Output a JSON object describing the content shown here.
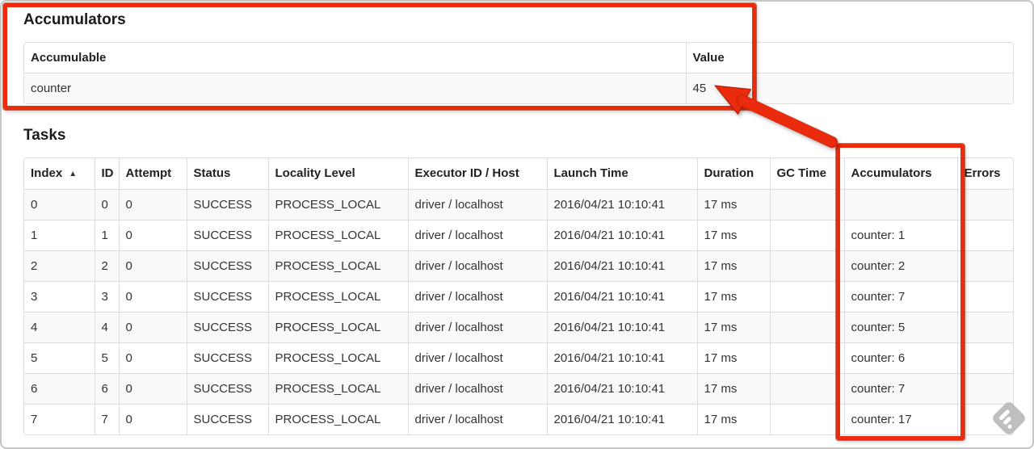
{
  "colors": {
    "annotation_red": "#ea2b0d",
    "table_border": "#dddddd",
    "row_stripe": "#f9f9f9",
    "text": "#333333",
    "watermark_gray": "#bababa"
  },
  "accumulators_section": {
    "title": "Accumulators",
    "table": {
      "headers": [
        "Accumulable",
        "Value"
      ],
      "row": {
        "accumulable": "counter",
        "value": "45"
      }
    }
  },
  "tasks_section": {
    "title": "Tasks",
    "table": {
      "headers": [
        "Index",
        "ID",
        "Attempt",
        "Status",
        "Locality Level",
        "Executor ID / Host",
        "Launch Time",
        "Duration",
        "GC Time",
        "Accumulators",
        "Errors"
      ],
      "sort": {
        "column": "Index",
        "direction": "ascending",
        "icon": "▲"
      },
      "rows": [
        [
          "0",
          "0",
          "0",
          "SUCCESS",
          "PROCESS_LOCAL",
          "driver / localhost",
          "2016/04/21 10:10:41",
          "17 ms",
          "",
          "",
          ""
        ],
        [
          "1",
          "1",
          "0",
          "SUCCESS",
          "PROCESS_LOCAL",
          "driver / localhost",
          "2016/04/21 10:10:41",
          "17 ms",
          "",
          "counter: 1",
          ""
        ],
        [
          "2",
          "2",
          "0",
          "SUCCESS",
          "PROCESS_LOCAL",
          "driver / localhost",
          "2016/04/21 10:10:41",
          "17 ms",
          "",
          "counter: 2",
          ""
        ],
        [
          "3",
          "3",
          "0",
          "SUCCESS",
          "PROCESS_LOCAL",
          "driver / localhost",
          "2016/04/21 10:10:41",
          "17 ms",
          "",
          "counter: 7",
          ""
        ],
        [
          "4",
          "4",
          "0",
          "SUCCESS",
          "PROCESS_LOCAL",
          "driver / localhost",
          "2016/04/21 10:10:41",
          "17 ms",
          "",
          "counter: 5",
          ""
        ],
        [
          "5",
          "5",
          "0",
          "SUCCESS",
          "PROCESS_LOCAL",
          "driver / localhost",
          "2016/04/21 10:10:41",
          "17 ms",
          "",
          "counter: 6",
          ""
        ],
        [
          "6",
          "6",
          "0",
          "SUCCESS",
          "PROCESS_LOCAL",
          "driver / localhost",
          "2016/04/21 10:10:41",
          "17 ms",
          "",
          "counter: 7",
          ""
        ],
        [
          "7",
          "7",
          "0",
          "SUCCESS",
          "PROCESS_LOCAL",
          "driver / localhost",
          "2016/04/21 10:10:41",
          "17 ms",
          "",
          "counter: 17",
          ""
        ]
      ]
    }
  }
}
